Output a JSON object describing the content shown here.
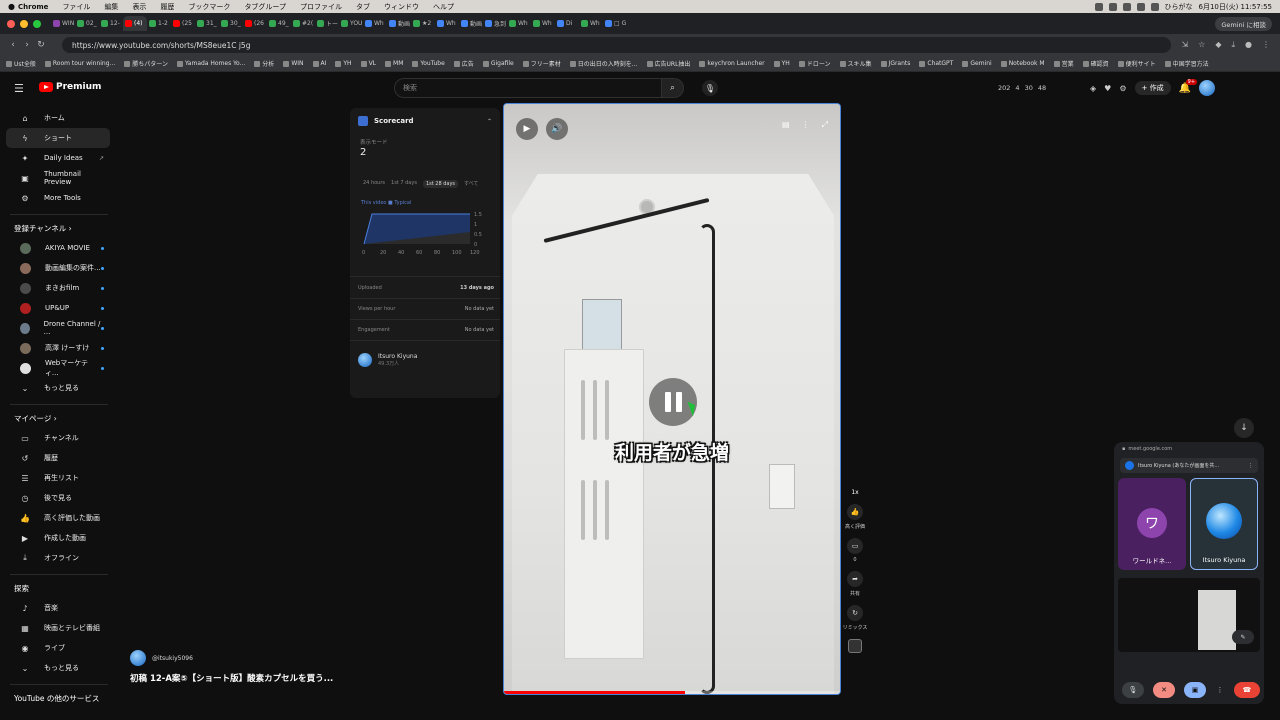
{
  "menubar": {
    "items": [
      "Chrome",
      "ファイル",
      "編集",
      "表示",
      "履歴",
      "ブックマーク",
      "タブグループ",
      "プロファイル",
      "タブ",
      "ウィンドウ",
      "ヘルプ"
    ],
    "input_method": "ひらがな",
    "clock": "6月10日(火) 11:57:55"
  },
  "chrome": {
    "tabs": [
      "WIN",
      "02_",
      "12-",
      "(4)",
      "1-2",
      "(25",
      "31_",
      "30_",
      "(26",
      "49_",
      "#2(",
      "トー",
      "YOU",
      "Wh",
      "動画",
      "★2",
      "Wh",
      "動画",
      "急到",
      "Wh",
      "Wh",
      "Di",
      "Wh",
      "□ G"
    ],
    "gemini_button": "Gemini に相談",
    "url": "https://www.youtube.com/shorts/MS8eue1C j5g",
    "bookmarks": [
      "Ust全般",
      "Room tour winning...",
      "勝ちパターン",
      "Yamada Homes Yo...",
      "分析",
      "WIN",
      "AI",
      "YH",
      "VL",
      "MM",
      "YouTube",
      "広告",
      "Gigafile",
      "フリー素材",
      "日の出日の入時刻を...",
      "広告URL抽出",
      "keychron Launcher",
      "YH",
      "ドローン",
      "スキル集",
      "JGrants",
      "ChatGPT",
      "Gemini",
      "Notebook M",
      "営業",
      "確認資",
      "便利サイト",
      "中国学習方法"
    ]
  },
  "youtube": {
    "logo_text": "Premium",
    "search_placeholder": "検索",
    "header_stats": [
      "202",
      "4",
      "30",
      "48"
    ],
    "create_label": "作成",
    "notification_count": "9+"
  },
  "sidebar": {
    "main": [
      {
        "label": "ホーム",
        "icon": "home-icon"
      },
      {
        "label": "ショート",
        "icon": "shorts-icon"
      },
      {
        "label": "Daily Ideas",
        "icon": "lightbulb-icon"
      },
      {
        "label": "Thumbnail Preview",
        "icon": "image-icon"
      },
      {
        "label": "More Tools",
        "icon": "tools-icon"
      }
    ],
    "subscriptions_title": "登録チャンネル",
    "channels": [
      {
        "label": "AKIYA MOVIE",
        "color": "#5b6b5b"
      },
      {
        "label": "動画編集の案件...",
        "color": "#8a6b5b"
      },
      {
        "label": "まきおfilm",
        "color": "#4b4b4b"
      },
      {
        "label": "UP&UP",
        "color": "#b02020"
      },
      {
        "label": "Drone Channel / ...",
        "color": "#6b7b8b"
      },
      {
        "label": "高澤 けーすけ",
        "color": "#7b6b5b"
      },
      {
        "label": "Webマーケティ...",
        "color": "#e0e0e0"
      }
    ],
    "show_more": "もっと見る",
    "you_title": "マイページ",
    "you_items": [
      {
        "label": "チャンネル",
        "icon": "channel-icon"
      },
      {
        "label": "履歴",
        "icon": "history-icon"
      },
      {
        "label": "再生リスト",
        "icon": "playlist-icon"
      },
      {
        "label": "後で見る",
        "icon": "watch-later-icon"
      },
      {
        "label": "高く評価した動画",
        "icon": "like-icon"
      },
      {
        "label": "作成した動画",
        "icon": "your-videos-icon"
      },
      {
        "label": "オフライン",
        "icon": "download-icon"
      }
    ],
    "explore_title": "探索",
    "explore_items": [
      {
        "label": "音楽",
        "icon": "music-icon"
      },
      {
        "label": "映画とテレビ番組",
        "icon": "movies-icon"
      },
      {
        "label": "ライブ",
        "icon": "live-icon"
      }
    ],
    "show_more_2": "もっと見る",
    "other_services": "YouTube の他のサービス"
  },
  "scorecard": {
    "title": "Scorecard",
    "mode_label": "表示モード",
    "mode_value": "2",
    "ranges": [
      "24 hours",
      "1st 7 days",
      "1st 28 days",
      "すべて"
    ],
    "selected_range": 2,
    "legend": "This video  ■ Typical",
    "chart_x_ticks": [
      "0",
      "20",
      "40",
      "60",
      "80",
      "100",
      "120"
    ],
    "chart_y_ticks": [
      "1.5",
      "1",
      "0.5",
      "0"
    ],
    "uploaded_label": "Uploaded",
    "uploaded_value": "13 days ago",
    "vph_label": "Views per hour",
    "vph_value": "No data yet",
    "engagement_label": "Engagement",
    "engagement_value": "No data yet",
    "creator_name": "Itsuro Kiyuna",
    "creator_subs": "49.3万人"
  },
  "video": {
    "caption": "利用者が急増",
    "progress_fraction": 0.54
  },
  "actions": {
    "speed": "1x",
    "like_label": "高く評価",
    "comment_count": "0",
    "share_label": "共有",
    "remix_label": "リミックス"
  },
  "below": {
    "channel_handle": "@itsukiy5096",
    "title": "初稿 12-A案⑤【ショート版】酸素カプセルを買う..."
  },
  "meet": {
    "url": "meet.google.com",
    "presenter": "Itsuro Kiyuna (あなたが画面を共...",
    "tile1_initial": "ワ",
    "tile1_name": "ワールドネ...",
    "tile2_name": "Itsuro Kiyuna"
  }
}
